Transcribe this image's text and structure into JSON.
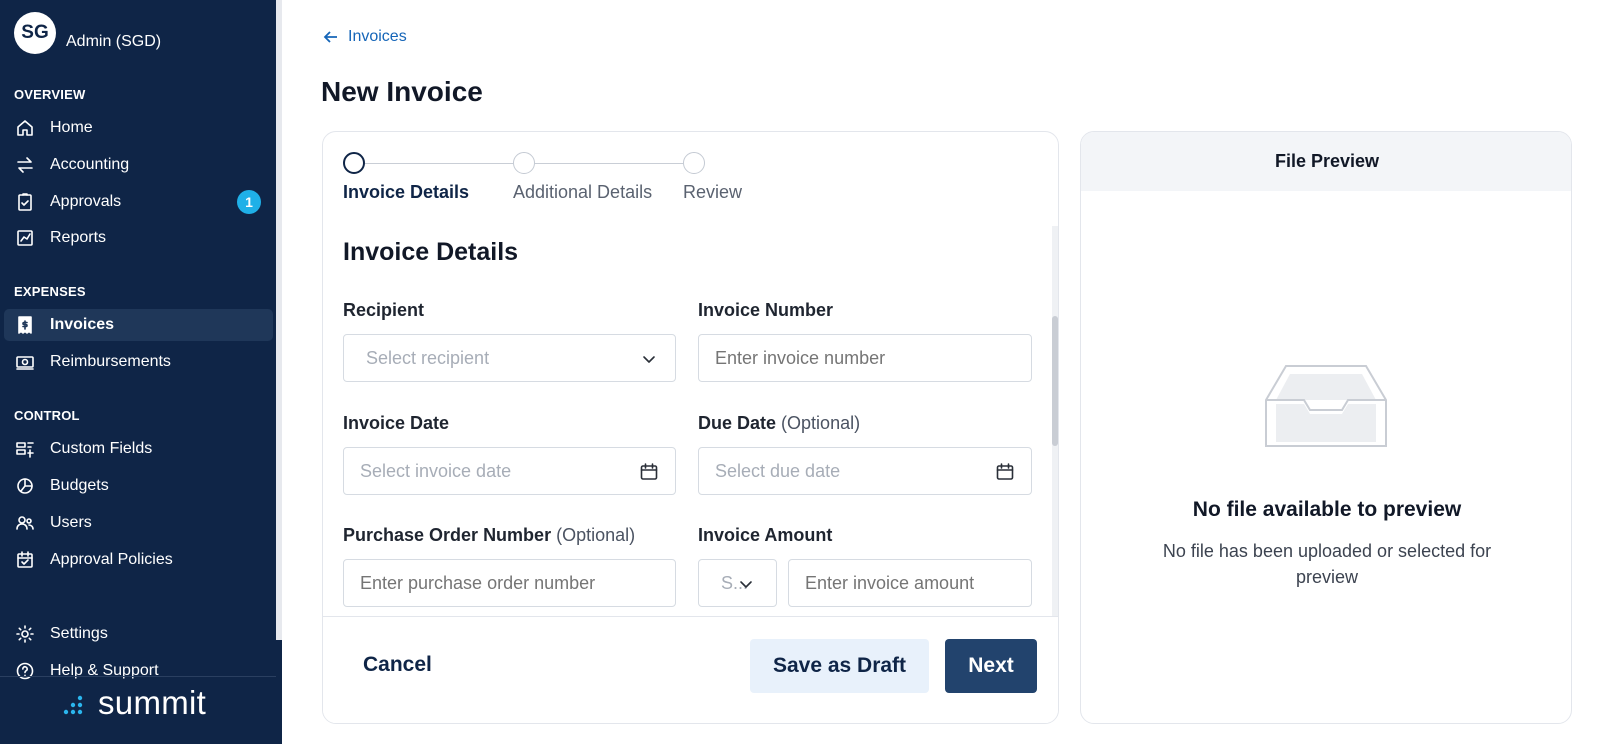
{
  "sidebar": {
    "avatar_initials": "SG",
    "profile_name": "Admin (SGD)",
    "sections": {
      "overview": "OVERVIEW",
      "expenses": "EXPENSES",
      "control": "CONTROL"
    },
    "items": {
      "home": "Home",
      "accounting": "Accounting",
      "approvals": "Approvals",
      "approvals_badge": "1",
      "reports": "Reports",
      "invoices": "Invoices",
      "reimbursements": "Reimbursements",
      "custom_fields": "Custom Fields",
      "budgets": "Budgets",
      "users": "Users",
      "approval_policies": "Approval Policies",
      "settings": "Settings",
      "help": "Help & Support"
    },
    "active_item": "invoices",
    "brand": "summit"
  },
  "breadcrumb": {
    "back_label": "Invoices"
  },
  "page_title": "New Invoice",
  "stepper": {
    "steps": [
      "Invoice Details",
      "Additional Details",
      "Review"
    ],
    "current_step": 0
  },
  "form": {
    "section_title": "Invoice Details",
    "recipient": {
      "label": "Recipient",
      "placeholder": "Select recipient"
    },
    "invoice_number": {
      "label": "Invoice Number",
      "placeholder": "Enter invoice number"
    },
    "invoice_date": {
      "label": "Invoice Date",
      "placeholder": "Select invoice date"
    },
    "due_date": {
      "label": "Due Date",
      "optional": "(Optional)",
      "placeholder": "Select due date"
    },
    "po_number": {
      "label": "Purchase Order Number",
      "optional": "(Optional)",
      "placeholder": "Enter purchase order number"
    },
    "invoice_amount": {
      "label": "Invoice Amount",
      "currency_placeholder": "S...",
      "placeholder": "Enter invoice amount"
    }
  },
  "footer": {
    "cancel": "Cancel",
    "save_draft": "Save as Draft",
    "next": "Next"
  },
  "preview": {
    "header": "File Preview",
    "empty_title": "No file available to preview",
    "empty_desc": "No file has been uploaded or selected for preview"
  },
  "colors": {
    "sidebar_bg": "#0f2547",
    "accent": "#22436d",
    "link": "#1565b8",
    "badge": "#1fb0e8"
  }
}
